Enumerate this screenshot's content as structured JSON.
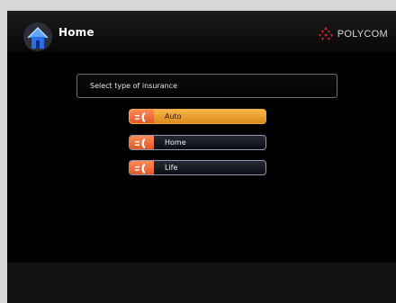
{
  "header": {
    "title": "Home",
    "home_icon": "house-icon",
    "brand": {
      "name": "POLYCOM",
      "logo_icon": "polycom-logo-icon",
      "color": "#d8232a"
    }
  },
  "prompt": {
    "text": "Select type of insurance"
  },
  "options": [
    {
      "label": "Auto",
      "icon": "phone-icon",
      "selected": true
    },
    {
      "label": "Home",
      "icon": "phone-icon",
      "selected": false
    },
    {
      "label": "Life",
      "icon": "phone-icon",
      "selected": false
    }
  ],
  "colors": {
    "selected_option": "#f0a83a",
    "option_badge": "#e86a3a",
    "option_border": "#8d96b2",
    "background": "#000000"
  }
}
